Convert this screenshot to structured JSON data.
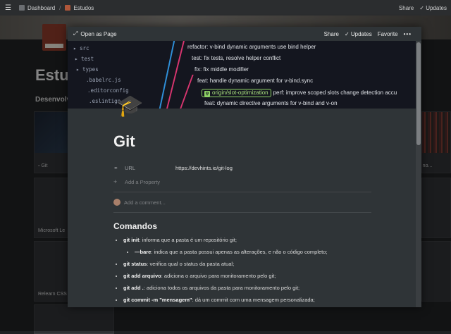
{
  "topbar": {
    "breadcrumb": [
      {
        "label": "Dashboard"
      },
      {
        "label": "Estudos"
      }
    ],
    "share_label": "Share",
    "updates_label": "Updates"
  },
  "background": {
    "title": "Estu",
    "section": "Desenvolv",
    "cards": [
      "Git",
      "Microsoft Le",
      "Relearn CSS",
      "minal no..."
    ]
  },
  "modal": {
    "open_as_page": "Open as Page",
    "share_label": "Share",
    "updates_label": "Updates",
    "favorite_label": "Favorite",
    "more_label": "•••",
    "cover": {
      "sidebar": [
        "src",
        "test",
        "types",
        ".babelrc.js",
        ".editorconfig",
        ".eslintign"
      ],
      "commits": [
        "refactor: v-bind dynamic arguments use bind helper",
        "test: fix tests, resolve helper conflict",
        "fix: fix middle modifier",
        "feat: handle dynamic argument for v-bind.sync",
        "perf: improve scoped slots change detection accu",
        "feat: dynamic directive arguments for v-bind and v-on"
      ],
      "branch": "origin/slot-optimization"
    },
    "page": {
      "title": "Git",
      "property_name": "URL",
      "property_value": "https://devhints.io/git-log",
      "add_property": "Add a Property",
      "add_comment": "Add a comment...",
      "section_title": "Comandos",
      "commands": [
        {
          "cmd": "git init",
          "desc": ": informa que a pasta é um repositório git;"
        },
        {
          "cmd": "—bare",
          "desc": ": indica que a pasta possui apenas as alterações, e não o código completo;",
          "sub": true
        },
        {
          "cmd": "git status",
          "desc": ": verifica qual o status da pasta atual;"
        },
        {
          "cmd": "git add arquivo",
          "desc": ": adiciona o arquivo para monitoramento pelo git;"
        },
        {
          "cmd": "git add .",
          "desc": ": adiciona todos os arquivos da pasta para monitoramento pelo git;"
        },
        {
          "cmd": "git commit -m \"mensagem\"",
          "desc": ": dá um commit com uma mensagem personalizada;"
        }
      ]
    }
  }
}
